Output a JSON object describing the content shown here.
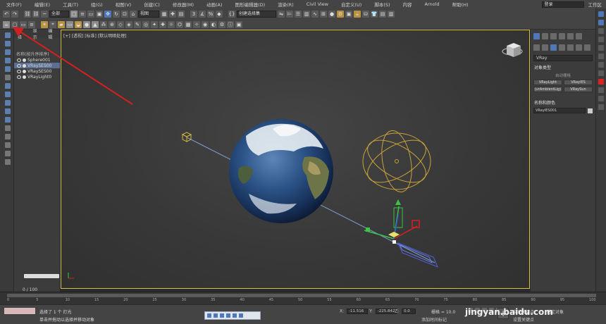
{
  "menubar": {
    "items": [
      "文件(F)",
      "编辑(E)",
      "工具(T)",
      "组(G)",
      "视图(V)",
      "创建(C)",
      "修改器(M)",
      "动画(A)",
      "图形编辑器(D)",
      "渲染(R)",
      "Civil View",
      "自定义(U)",
      "脚本(S)",
      "内容",
      "Arnold",
      "帮助(H)"
    ],
    "login": "登录",
    "workspace": "工作区"
  },
  "toolbar": {
    "filter_select": "全部",
    "view_select": "视图",
    "selection_set": "创建选择集"
  },
  "scene_explorer": {
    "tabs": [
      "选择",
      "显示",
      "编辑"
    ],
    "header": "名称(按升序排序)",
    "objects": [
      "Sphere001",
      "VRaySES00",
      "VRaySES00",
      "VRayLight0"
    ],
    "frame_indicator": "0 / 100"
  },
  "viewport": {
    "label": "[+] [透视] [标准] [默认明暗处理]"
  },
  "command_panel": {
    "category_dropdown": "VRay",
    "object_type_title": "对象类型",
    "auto_grid": "自动栅格",
    "buttons": [
      "VRayLight",
      "VRayIES",
      "(vrAmbientLig)",
      "VRaySun"
    ],
    "name_color_title": "名称和颜色",
    "name_value": "VRayIES001"
  },
  "timeline": {
    "ticks": [
      "0",
      "5",
      "10",
      "15",
      "20",
      "25",
      "30",
      "35",
      "40",
      "45",
      "50",
      "55",
      "60",
      "65",
      "70",
      "75",
      "80",
      "85",
      "90",
      "95",
      "100"
    ]
  },
  "status": {
    "selected": "选择了 1 个 灯光",
    "hint": "单击并拖动以选择并移动对象",
    "x_label": "X:",
    "x_value": "-11.516",
    "y_label": "Y:",
    "y_value": "-225.842",
    "z_label": "Z:",
    "z_value": "0.0",
    "grid": "栅格 = 10.0",
    "time_config": "添加时间标记",
    "auto_key": "自动关键点",
    "set_key": "设置关键点",
    "key_filter": "选定对象",
    "watermark": "jingyan.baidu.com"
  },
  "colors": {
    "accent_blue": "#4f78b8",
    "viewport_border": "#d6c24b",
    "arrow_red": "#d42020",
    "light_gold": "#c9a23a"
  }
}
